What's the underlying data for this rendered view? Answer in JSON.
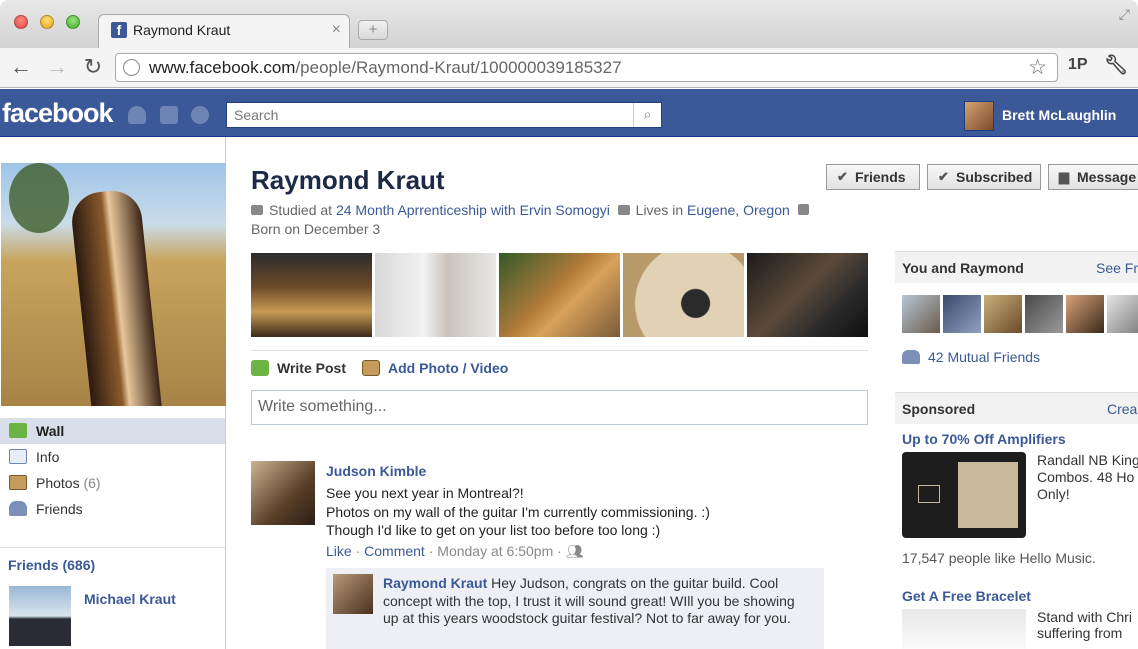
{
  "browser": {
    "tab_title": "Raymond Kraut",
    "tab_close": "×",
    "new_tab": "+",
    "url_host": "www.facebook.com",
    "url_path": "/people/Raymond-Kraut/100000039185327",
    "ext_1p": "1P"
  },
  "fb": {
    "logo": "facebook",
    "search_placeholder": "Search",
    "user_name": "Brett McLaughlin"
  },
  "profile": {
    "name": "Raymond Kraut",
    "studied_prefix": "Studied at",
    "studied_link": "24 Month Aprrenticeship with Ervin Somogyi",
    "lives_prefix": "Lives in",
    "lives_link": "Eugene, Oregon",
    "born": "Born on December 3"
  },
  "buttons": {
    "friends": "Friends",
    "subscribed": "Subscribed",
    "message": "Message"
  },
  "leftnav": [
    {
      "label": "Wall",
      "count": ""
    },
    {
      "label": "Info",
      "count": ""
    },
    {
      "label": "Photos",
      "count": "(6)"
    },
    {
      "label": "Friends",
      "count": ""
    }
  ],
  "friends_box": {
    "title": "Friends (686)",
    "friend_name": "Michael Kraut"
  },
  "composer": {
    "write_post": "Write Post",
    "add_photo": "Add Photo / Video",
    "placeholder": "Write something..."
  },
  "post": {
    "author": "Judson Kimble",
    "lines": [
      "See you next year in Montreal?!",
      "Photos on my wall of the guitar I'm currently commissioning. :)",
      "Though I'd like to get on your list too before too long :)"
    ],
    "like": "Like",
    "comment": "Comment",
    "time": "Monday at 6:50pm",
    "reply_author": "Raymond Kraut",
    "reply_text": "Hey Judson, congrats on the guitar build. Cool concept with the top, I trust it will sound great! WIll you be showing up at this years woodstock guitar festival? Not to far away for you."
  },
  "sidebar": {
    "you_and": "You and Raymond",
    "see_friendship": "See Fr",
    "mutual_friends": "42 Mutual Friends",
    "sponsored": "Sponsored",
    "create_ad": "Crea",
    "ad1": {
      "title": "Up to 70% Off Amplifiers",
      "text": "Randall NB King Combos. 48 Ho Only!",
      "likes": "17,547 people like Hello Music."
    },
    "ad2": {
      "title": "Get A Free Bracelet",
      "text": "Stand with Chri suffering from"
    }
  }
}
